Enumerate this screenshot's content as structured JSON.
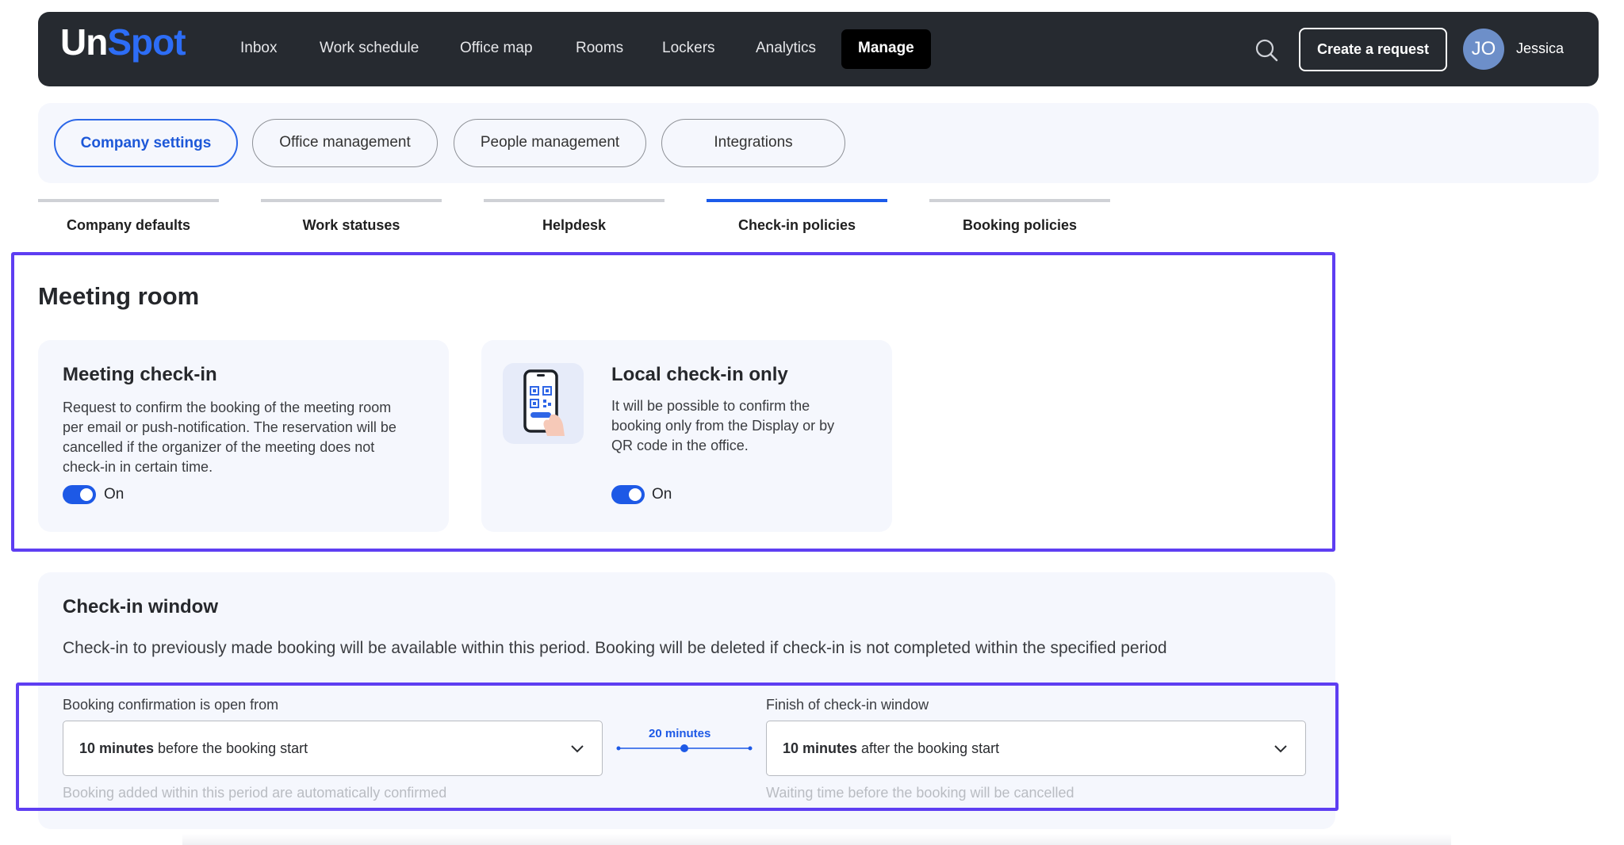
{
  "app": {
    "logo_part1": "Un",
    "logo_part2": "Spot",
    "accent_color": "#1d59e6"
  },
  "nav": {
    "items": [
      {
        "label": "Inbox"
      },
      {
        "label": "Work schedule"
      },
      {
        "label": "Office map"
      },
      {
        "label": "Rooms"
      },
      {
        "label": "Lockers"
      },
      {
        "label": "Analytics"
      },
      {
        "label": "Manage",
        "active": true
      }
    ],
    "search_icon": "search-icon",
    "create_request_label": "Create a request",
    "user": {
      "initials": "JO",
      "name": "Jessica"
    }
  },
  "settings_tabs": [
    {
      "label": "Company settings",
      "active": true
    },
    {
      "label": "Office management"
    },
    {
      "label": "People management"
    },
    {
      "label": "Integrations"
    }
  ],
  "sub_tabs": [
    {
      "label": "Company defaults"
    },
    {
      "label": "Work statuses"
    },
    {
      "label": "Helpdesk"
    },
    {
      "label": "Check-in policies",
      "active": true
    },
    {
      "label": "Booking policies"
    }
  ],
  "meeting_room": {
    "title": "Meeting room",
    "meeting_checkin": {
      "title": "Meeting check-in",
      "desc_lines": [
        "Request to confirm the booking of the meeting room",
        "per email or push-notification. The reservation will be",
        "cancelled if the organizer of the meeting does not",
        "check-in in certain time."
      ],
      "toggle_on": true,
      "toggle_label": "On"
    },
    "local_checkin": {
      "title": "Local check-in only",
      "desc_lines": [
        "It will be possible to confirm the",
        "booking only from the Display or by",
        "QR code in the office."
      ],
      "icon": "phone-qr-code-icon",
      "toggle_on": true,
      "toggle_label": "On"
    }
  },
  "checkin_window": {
    "title": "Check-in window",
    "description": "Check-in to previously made booking will be available within this period. Booking will be deleted if check-in is not completed within the specified period",
    "open_from": {
      "label": "Booking confirmation is open from",
      "value_bold": "10 minutes",
      "value_rest": " before the booking start",
      "helper": "Booking added within this period are automatically confirmed"
    },
    "window_length": "20 minutes",
    "finish": {
      "label": "Finish of check-in window",
      "value_bold": "10 minutes",
      "value_rest": " after the booking start",
      "helper": "Waiting time before the booking will be cancelled"
    }
  }
}
